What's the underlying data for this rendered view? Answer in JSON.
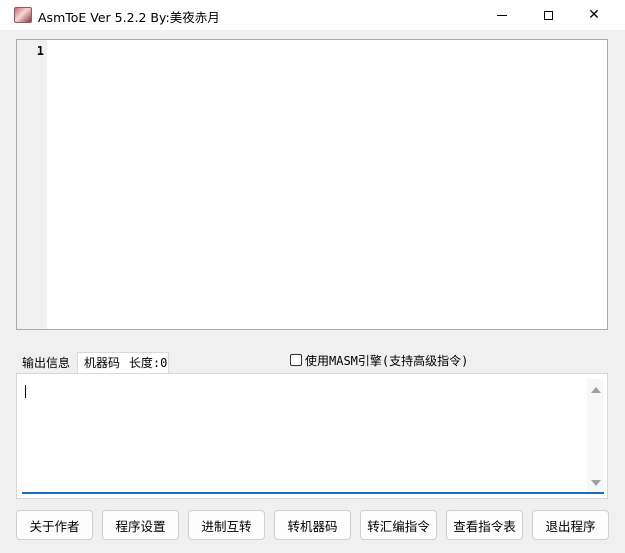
{
  "window": {
    "title": "AsmToE Ver 5.2.2  By:美夜赤月",
    "minimize_icon": "minimize-icon",
    "maximize_icon": "maximize-icon",
    "close_icon": "close-icon",
    "close_glyph": "✕"
  },
  "editor": {
    "line_numbers": [
      "1"
    ],
    "content": ""
  },
  "tabs": {
    "output_info": "输出信息",
    "machine_code": "机器码",
    "length_label": "长度:0"
  },
  "masm_checkbox": {
    "label": "使用MASM引擎(支持高级指令)",
    "checked": false
  },
  "output": {
    "value": ""
  },
  "buttons": {
    "about": "关于作者",
    "settings": "程序设置",
    "base_convert": "进制互转",
    "to_machine_code": "转机器码",
    "to_assembly": "转汇编指令",
    "view_instructions": "查看指令表",
    "exit": "退出程序"
  },
  "colors": {
    "accent": "#1a6fc0",
    "background": "#f0f0f0"
  }
}
